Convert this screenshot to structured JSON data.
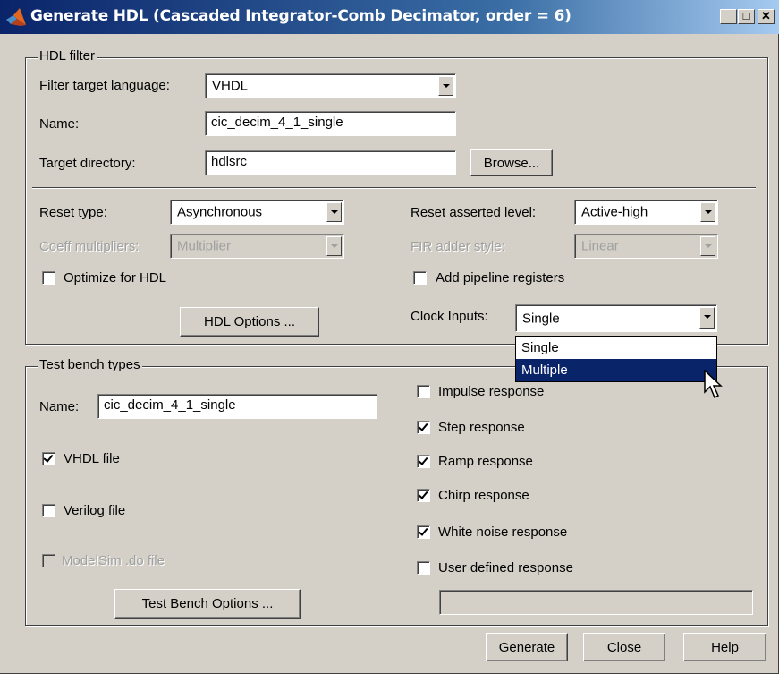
{
  "window": {
    "title": "Generate HDL (Cascaded Integrator-Comb Decimator, order = 6)",
    "minimize_glyph": "_",
    "maximize_glyph": "□",
    "close_glyph": "✕"
  },
  "hdl_filter": {
    "group_label": "HDL filter",
    "target_language_label": "Filter target language:",
    "target_language_value": "VHDL",
    "name_label": "Name:",
    "name_value": "cic_decim_4_1_single",
    "target_dir_label": "Target directory:",
    "target_dir_value": "hdlsrc",
    "browse_label": "Browse...",
    "reset_type_label": "Reset type:",
    "reset_type_value": "Asynchronous",
    "coeff_mult_label": "Coeff multipliers:",
    "coeff_mult_value": "Multiplier",
    "optimize_label": "Optimize for HDL",
    "optimize_checked": false,
    "hdl_options_label": "HDL Options ...",
    "reset_level_label": "Reset asserted level:",
    "reset_level_value": "Active-high",
    "fir_adder_label": "FIR adder style:",
    "fir_adder_value": "Linear",
    "pipeline_label": "Add pipeline registers",
    "pipeline_checked": false,
    "clock_inputs_label": "Clock Inputs:",
    "clock_inputs_value": "Single",
    "clock_inputs_options": [
      "Single",
      "Multiple"
    ],
    "clock_inputs_highlighted": "Multiple"
  },
  "test_bench": {
    "group_label": "Test bench types",
    "name_label": "Name:",
    "name_value": "cic_decim_4_1_single",
    "vhdl_label": "VHDL file",
    "verilog_label": "Verilog file",
    "modelsim_label": "ModelSim .do file",
    "tb_options_label": "Test Bench Options ...",
    "impulse_label": "Impulse response",
    "step_label": "Step response",
    "ramp_label": "Ramp response",
    "chirp_label": "Chirp response",
    "white_noise_label": "White noise response",
    "user_defined_label": "User defined response",
    "user_defined_value": "",
    "checks": {
      "vhdl": true,
      "verilog": false,
      "modelsim": false,
      "impulse": false,
      "step": true,
      "ramp": true,
      "chirp": true,
      "white_noise": true,
      "user_defined": false
    }
  },
  "footer": {
    "generate_label": "Generate",
    "close_label": "Close",
    "help_label": "Help"
  },
  "colors": {
    "face": "#d4d0c8",
    "title_start": "#0a246a",
    "title_end": "#a6caf0",
    "selection": "#0a246a"
  }
}
